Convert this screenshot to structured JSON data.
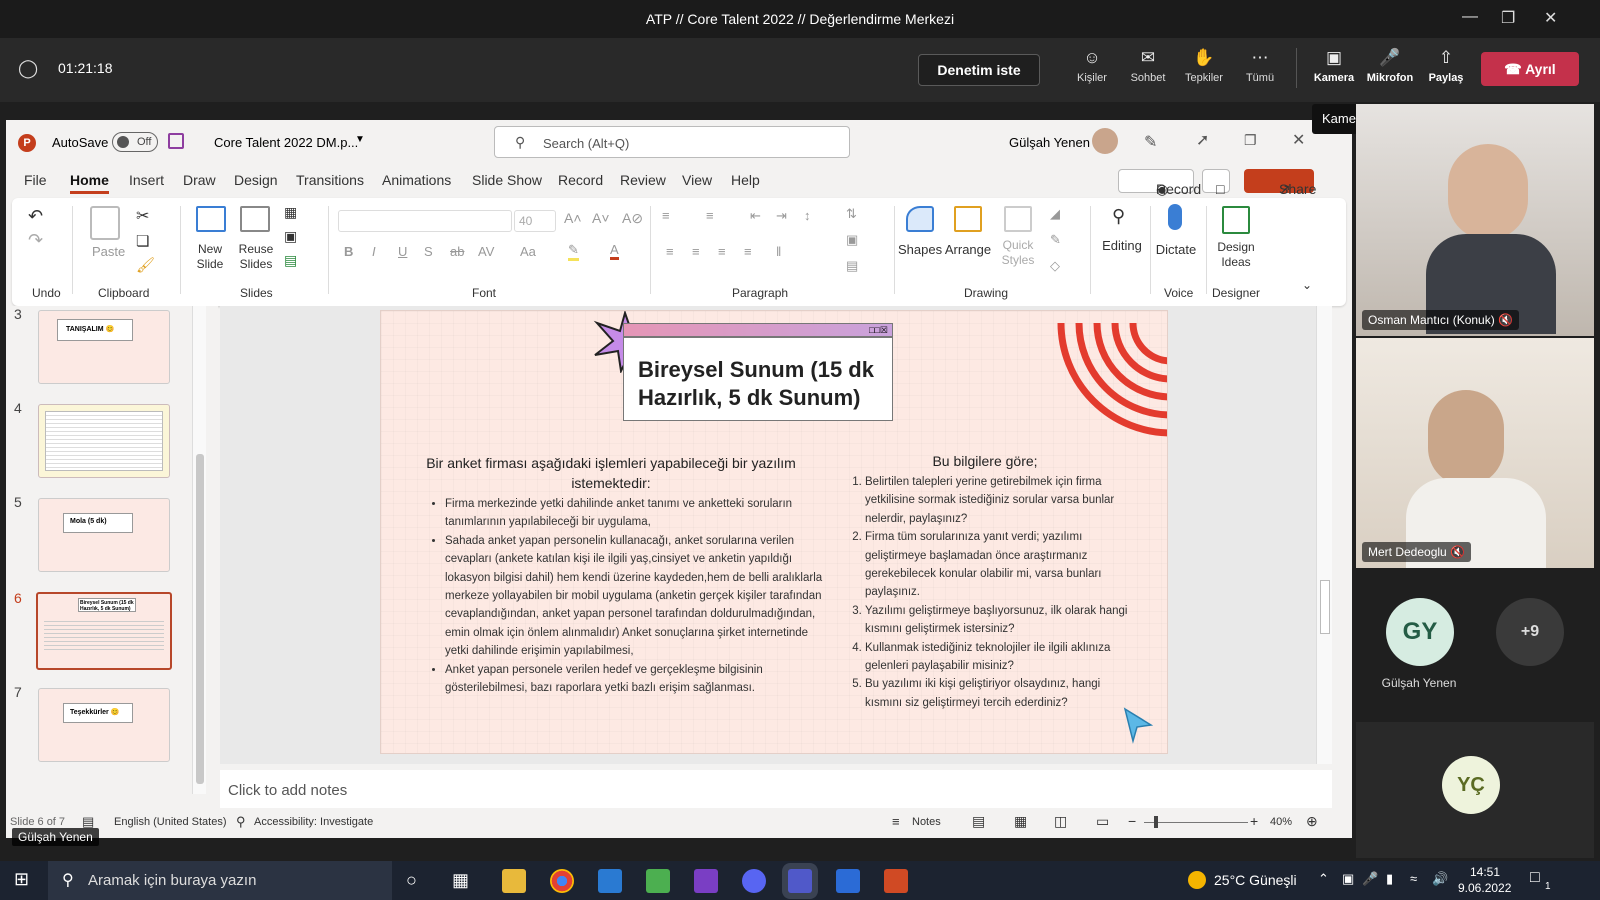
{
  "teams": {
    "window_title": "ATP // Core Talent 2022 // Değerlendirme Merkezi",
    "timer": "01:21:18",
    "request_control": "Denetim iste",
    "buttons": [
      {
        "label": "Kişiler",
        "icon": "people-icon"
      },
      {
        "label": "Sohbet",
        "icon": "chat-icon"
      },
      {
        "label": "Tepkiler",
        "icon": "reactions-icon"
      },
      {
        "label": "Tümü",
        "icon": "more-icon"
      },
      {
        "label": "Kamera",
        "icon": "camera-off-icon"
      },
      {
        "label": "Mikrofon",
        "icon": "mic-off-icon"
      },
      {
        "label": "Paylaş",
        "icon": "share-icon"
      }
    ],
    "leave": "Ayrıl",
    "tooltip": "Kamerayı aç (Ctrl+Shift+O)",
    "participants": [
      {
        "name": "Osman Mantıcı (Konuk)"
      },
      {
        "name": "Mert Dedeoglu"
      }
    ],
    "avatars": [
      {
        "initials": "GY",
        "name": "Gülşah Yenen"
      },
      {
        "initials": "+9",
        "name": ""
      },
      {
        "initials": "YÇ",
        "name": ""
      }
    ],
    "presenter_tag": "Gülşah Yenen"
  },
  "ppt": {
    "autosave": "AutoSave",
    "autosave_state": "Off",
    "filename": "Core Talent 2022 DM.p...",
    "search_placeholder": "Search (Alt+Q)",
    "user": "Gülşah Yenen",
    "menu": [
      "File",
      "Home",
      "Insert",
      "Draw",
      "Design",
      "Transitions",
      "Animations",
      "Slide Show",
      "Record",
      "Review",
      "View",
      "Help"
    ],
    "record": "Record",
    "share": "Share",
    "ribbon": {
      "undo": "Undo",
      "clipboard": "Clipboard",
      "paste": "Paste",
      "new_slide": "New Slide",
      "reuse_slides": "Reuse Slides",
      "slides": "Slides",
      "font_size": "40",
      "font": "Font",
      "paragraph": "Paragraph",
      "shapes": "Shapes",
      "arrange": "Arrange",
      "quick_styles": "Quick Styles",
      "drawing": "Drawing",
      "editing": "Editing",
      "dictate": "Dictate",
      "voice": "Voice",
      "design_ideas": "Design Ideas",
      "designer": "Designer"
    },
    "thumbs": [
      {
        "num": "3",
        "title": "TANIŞALIM 😊"
      },
      {
        "num": "4",
        "title": ""
      },
      {
        "num": "5",
        "title": "Mola (5 dk)"
      },
      {
        "num": "6",
        "title": "Bireysel Sunum (15 dk Hazırlık, 5 dk Sunum)"
      },
      {
        "num": "7",
        "title": "Teşekkürler 😊"
      }
    ],
    "slide": {
      "title": "Bireysel Sunum (15 dk Hazırlık, 5 dk Sunum)",
      "left_heading": "Bir anket firması aşağıdaki işlemleri yapabileceği bir yazılım istemektedir:",
      "left_items": [
        "Firma merkezinde yetki dahilinde anket tanımı ve anketteki soruların tanımlarının yapılabileceği bir uygulama,",
        "Sahada anket yapan personelin kullanacağı, anket sorularına verilen cevapları (ankete katılan kişi ile ilgili yaş,cinsiyet ve anketin yapıldığı lokasyon bilgisi dahil) hem kendi üzerine kaydeden,hem de belli aralıklarla merkeze yollayabilen bir mobil uygulama (anketin gerçek kişiler tarafından cevaplandığından, anket yapan personel tarafından doldurulmadığından, emin olmak için önlem alınmalıdır) Anket sonuçlarına şirket internetinde yetki dahilinde erişimin yapılabilmesi,",
        "Anket yapan personele verilen hedef ve gerçekleşme bilgisinin gösterilebilmesi, bazı raporlara yetki bazlı erişim sağlanması."
      ],
      "right_heading": "Bu bilgilere göre;",
      "right_items": [
        "Belirtilen talepleri yerine getirebilmek için firma yetkilisine sormak istediğiniz sorular varsa bunlar nelerdir, paylaşınız?",
        "Firma tüm sorularınıza yanıt verdi; yazılımı geliştirmeye başlamadan önce araştırmanız gerekebilecek konular olabilir mi, varsa bunları paylaşınız.",
        "Yazılımı geliştirmeye başlıyorsunuz, ilk olarak hangi kısmını geliştirmek istersiniz?",
        "Kullanmak istediğiniz teknolojiler ile ilgili aklınıza gelenleri paylaşabilir misiniz?",
        "Bu yazılımı iki kişi geliştiriyor olsaydınız, hangi kısmını siz geliştirmeyi tercih ederdiniz?"
      ]
    },
    "notes_placeholder": "Click to add notes",
    "status": {
      "slide": "Slide 6 of 7",
      "language": "English (United States)",
      "accessibility": "Accessibility: Investigate",
      "notes": "Notes",
      "zoom": "40%"
    }
  },
  "taskbar": {
    "search": "Aramak için buraya yazın",
    "weather": "25°C  Güneşli",
    "time": "14:51",
    "date": "9.06.2022",
    "notif": "1"
  },
  "colors": {
    "accent": "#c43e1c",
    "leave": "#c4314b",
    "slide_bg": "#fde9e3",
    "stripe": "#e33b2e"
  }
}
